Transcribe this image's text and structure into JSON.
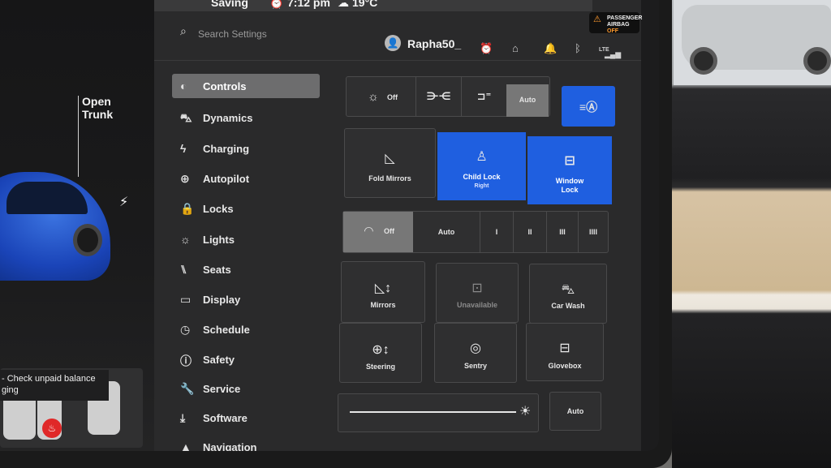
{
  "status": {
    "left_text": "Saving",
    "time": "7:12 pm",
    "temp": "19°C"
  },
  "airbag": {
    "line1": "PASSENGER",
    "line2": "AIRBAG",
    "line3": "OFF"
  },
  "search": {
    "placeholder": "Search Settings"
  },
  "user": {
    "name": "Rapha50_"
  },
  "header_icons": [
    "alarm-icon",
    "home-icon",
    "bell-icon",
    "bluetooth-icon",
    "signal-icon"
  ],
  "lte": "LTE",
  "car": {
    "trunk_label_line1": "Open",
    "trunk_label_line2": "Trunk"
  },
  "notice": {
    "line1": "- Check unpaid balance",
    "line2": "ging"
  },
  "nav": {
    "items": [
      {
        "label": "Controls",
        "icon": "toggle-icon",
        "active": true
      },
      {
        "label": "Dynamics",
        "icon": "car-icon"
      },
      {
        "label": "Charging",
        "icon": "bolt-icon"
      },
      {
        "label": "Autopilot",
        "icon": "steering-icon"
      },
      {
        "label": "Locks",
        "icon": "lock-icon"
      },
      {
        "label": "Lights",
        "icon": "sun-icon"
      },
      {
        "label": "Seats",
        "icon": "seat-icon"
      },
      {
        "label": "Display",
        "icon": "display-icon"
      },
      {
        "label": "Schedule",
        "icon": "clock-icon"
      },
      {
        "label": "Safety",
        "icon": "alert-icon"
      },
      {
        "label": "Service",
        "icon": "wrench-icon"
      },
      {
        "label": "Software",
        "icon": "download-icon"
      },
      {
        "label": "Navigation",
        "icon": "navigation-icon"
      }
    ]
  },
  "lights": {
    "off": "Off",
    "auto": "Auto",
    "selected": "Auto"
  },
  "controls": {
    "fold_mirrors": "Fold Mirrors",
    "child_lock": "Child Lock",
    "child_lock_sub": "Right",
    "window_lock_1": "Window",
    "window_lock_2": "Lock"
  },
  "wipers": {
    "off": "Off",
    "auto": "Auto",
    "levels": [
      "I",
      "II",
      "III",
      "IIII"
    ],
    "selected": "Off"
  },
  "grid": {
    "mirrors": "Mirrors",
    "unavailable": "Unavailable",
    "car_wash": "Car Wash",
    "steering": "Steering",
    "sentry": "Sentry",
    "glovebox": "Glovebox"
  },
  "brightness": {
    "auto": "Auto",
    "value": 0.96
  },
  "colors": {
    "accent": "#1f5fe0",
    "selected_gray": "#777777",
    "panel": "#2a2a2b"
  }
}
